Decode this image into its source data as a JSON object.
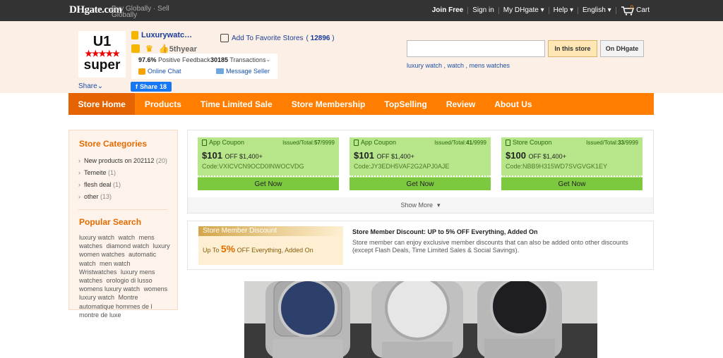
{
  "topbar": {
    "logo": "DHgate.com",
    "tagline": "Buy Globally · Sell Globally",
    "join": "Join Free",
    "signin": "Sign in",
    "mydhgate": "My DHgate",
    "help": "Help",
    "language": "English",
    "cart_count": "0",
    "cart": "Cart"
  },
  "store": {
    "logo_line1": "U1",
    "logo_stars": "★★★★★",
    "logo_line3": "super",
    "name": "Luxurywatc…",
    "years": "5thyear",
    "feedback_pct": "97.6%",
    "feedback_label": "Positive Feedback",
    "transactions": "30185",
    "transactions_label": "Transactions",
    "chat": "Online Chat",
    "message": "Message Seller",
    "share": "Share",
    "fb_label": "Share",
    "fb_count": "18",
    "favorite_label": "Add To Favorite Stores",
    "favorite_count": "12896"
  },
  "search": {
    "value": "",
    "in_store": "In this store",
    "on_dhgate": "On DHgate",
    "hot": "luxury watch , watch , mens watches"
  },
  "nav": {
    "items": [
      "Store Home",
      "Products",
      "Time Limited Sale",
      "Store Membership",
      "TopSelling",
      "Review",
      "About Us"
    ]
  },
  "sidebar": {
    "categories_title": "Store Categories",
    "categories": [
      {
        "label": "New products on 202112",
        "count": "(20)"
      },
      {
        "label": "Temeite",
        "count": "(1)"
      },
      {
        "label": "flesh deal",
        "count": "(1)"
      },
      {
        "label": "other",
        "count": "(13)"
      }
    ],
    "popular_title": "Popular Search",
    "popular": [
      "luxury watch",
      "watch",
      "mens watches",
      "diamond watch",
      "luxury women watches",
      "automatic watch",
      "men watch",
      "Wristwatches",
      "luxury mens watches",
      "orologio di lusso",
      "womens luxury watch",
      "womens luxury watch",
      "Montre automatique hommes de l",
      "montre de luxe"
    ]
  },
  "coupons": [
    {
      "type": "App Coupon",
      "issued_label": "Issued/Total:",
      "issued": "57",
      "total": "/9999",
      "amount": "$101",
      "off": "OFF $1,400+",
      "code": "Code:VXICVCN9OCD0INWOCVDG",
      "cta": "Get Now"
    },
    {
      "type": "App Coupon",
      "issued_label": "Issued/Total:",
      "issued": "41",
      "total": "/9999",
      "amount": "$101",
      "off": "OFF $1,400+",
      "code": "Code:JY3EDH5VAF2G2APJ0AJE",
      "cta": "Get Now"
    },
    {
      "type": "Store Coupon",
      "issued_label": "Issued/Total:",
      "issued": "33",
      "total": "/9999",
      "amount": "$100",
      "off": "OFF $1,400+",
      "code": "Code:NBB9H315WD7SVGVGK1EY",
      "cta": "Get Now"
    }
  ],
  "show_more": "Show More",
  "member": {
    "head": "Store Member Discount",
    "up_to": "Up To",
    "pct": "5%",
    "rest": "OFF Everything, Added On",
    "title": "Store Member Discount: UP to 5% OFF Everything, Added On",
    "desc": "Store member can enjoy exclusive member discounts that can also be added onto other discounts (except Flash Deals, Time Limited Sales & Social Savings)."
  },
  "colors": {
    "accent": "#ff7d00",
    "coupon_bg": "#b6e58a",
    "coupon_cta": "#7cc83f",
    "header_bg": "#fcefe5"
  }
}
